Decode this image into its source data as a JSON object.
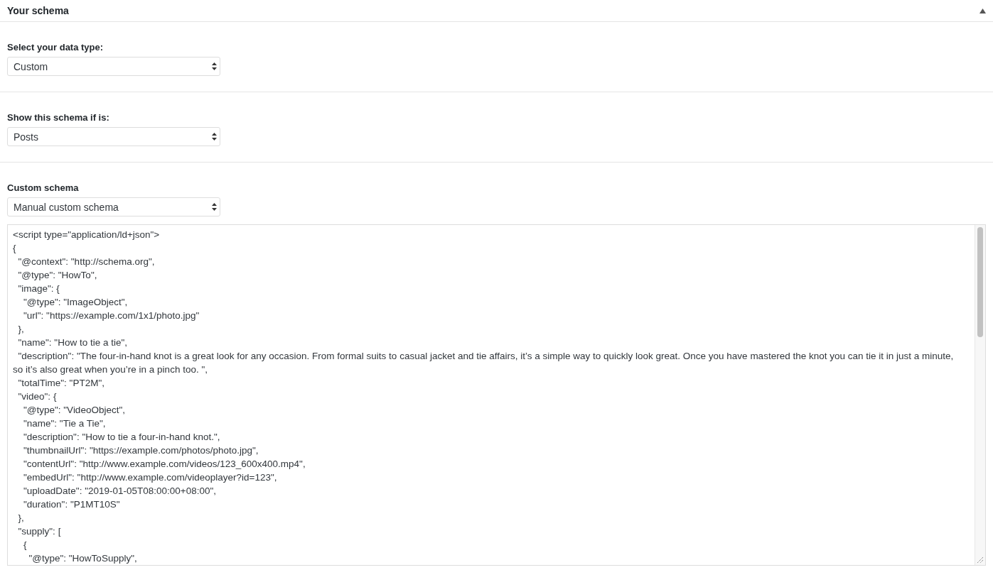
{
  "panel": {
    "title": "Your schema",
    "expanded": true
  },
  "fields": [
    {
      "label": "Select your data type:",
      "value": "Custom"
    },
    {
      "label": "Show this schema if is:",
      "value": "Posts"
    },
    {
      "label": "Custom schema",
      "value": "Manual custom schema"
    }
  ],
  "code_editor": {
    "lines": [
      "<script type=\"application/ld+json\">",
      "{",
      "  \"@context\": \"http://schema.org\",",
      "  \"@type\": \"HowTo\",",
      "  \"image\": {",
      "    \"@type\": \"ImageObject\",",
      "    \"url\": \"https://example.com/1x1/photo.jpg\"",
      "  },",
      "  \"name\": \"How to tie a tie\",",
      "  \"description\": \"The four-in-hand knot is a great look for any occasion. From formal suits to casual jacket and tie affairs, it’s a simple way to quickly look great. Once you have mastered the knot you can tie it in just a minute, so it’s also great when you’re in a pinch too. \",",
      "  \"totalTime\": \"PT2M\",",
      "  \"video\": {",
      "    \"@type\": \"VideoObject\",",
      "    \"name\": \"Tie a Tie\",",
      "    \"description\": \"How to tie a four-in-hand knot.\",",
      "    \"thumbnailUrl\": \"https://example.com/photos/photo.jpg\",",
      "    \"contentUrl\": \"http://www.example.com/videos/123_600x400.mp4\",",
      "    \"embedUrl\": \"http://www.example.com/videoplayer?id=123\",",
      "    \"uploadDate\": \"2019-01-05T08:00:00+08:00\",",
      "    \"duration\": \"P1MT10S\"",
      "  },",
      "  \"supply\": [",
      "    {",
      "      \"@type\": \"HowToSupply\","
    ]
  }
}
